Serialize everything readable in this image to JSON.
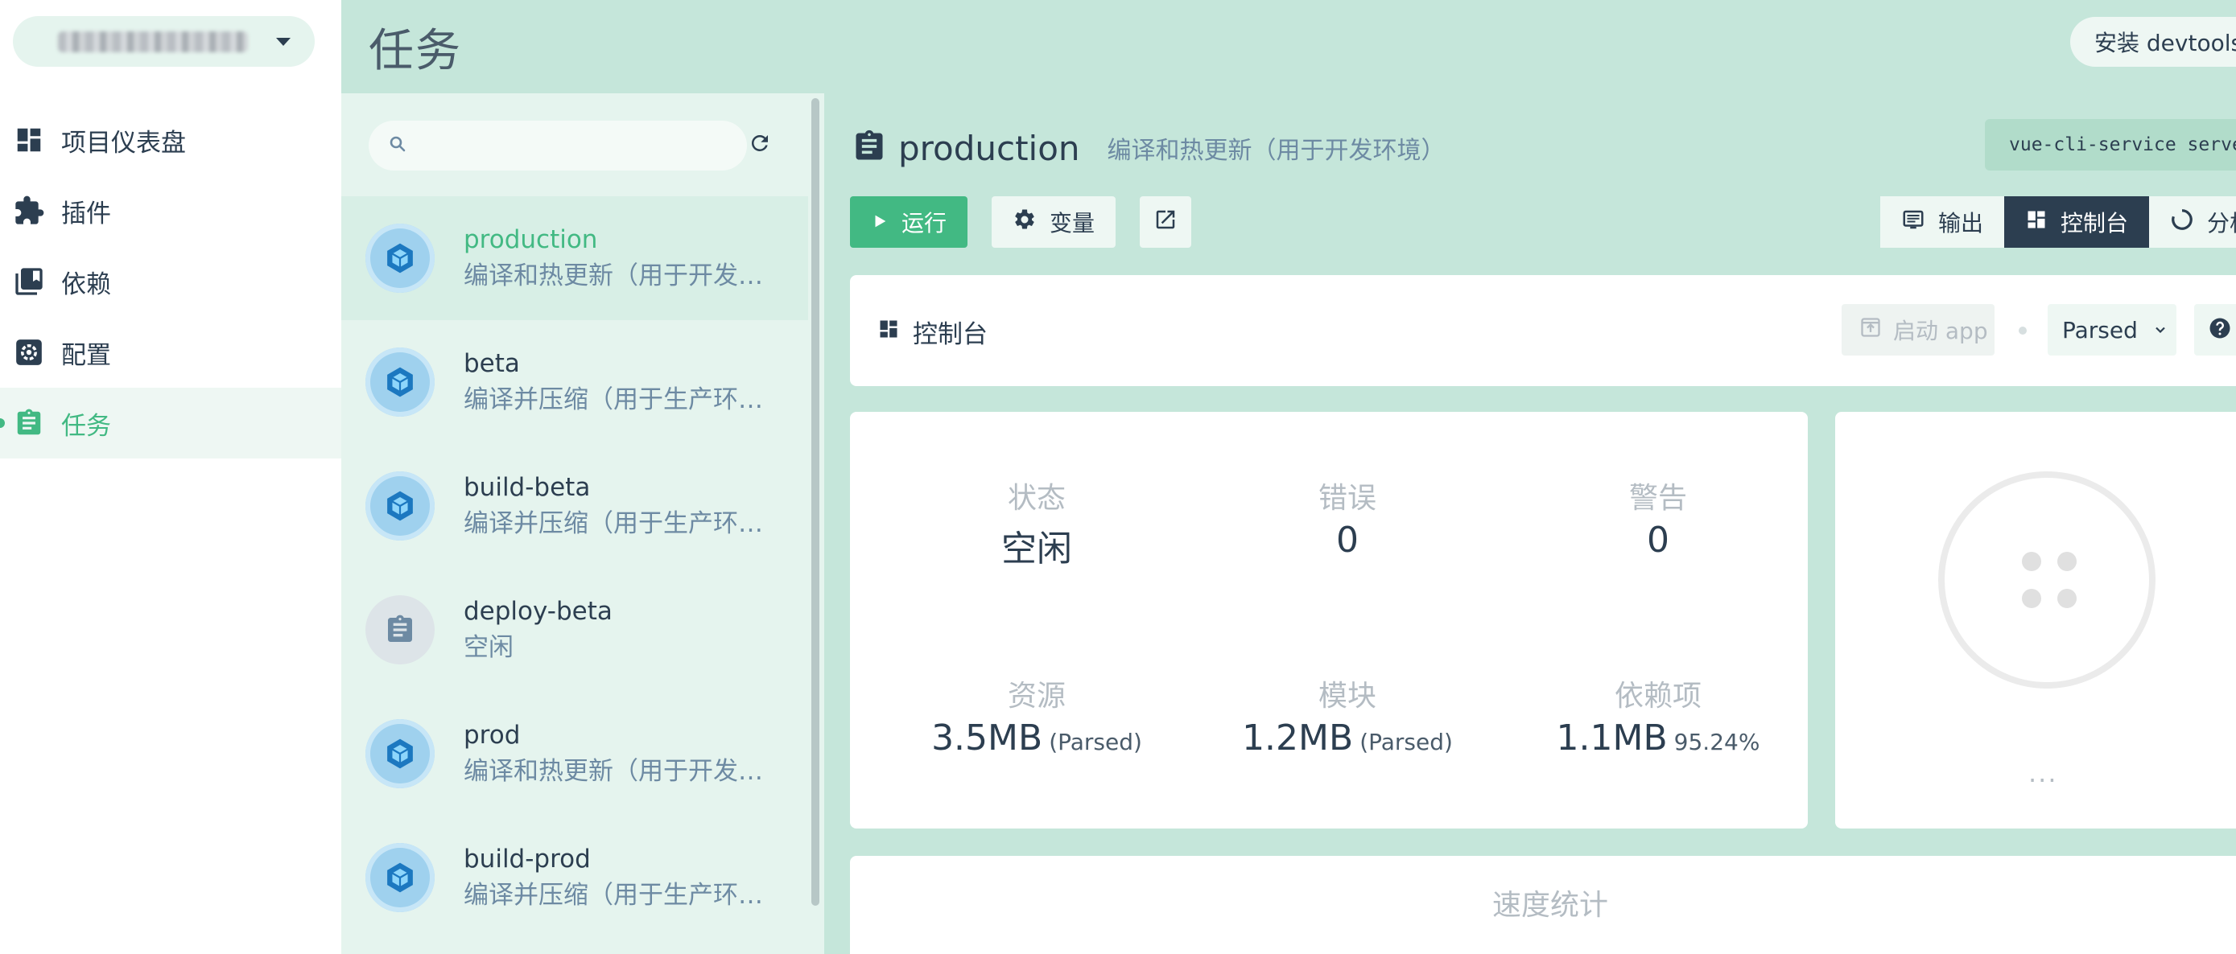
{
  "nav": {
    "items": [
      {
        "label": "项目仪表盘",
        "icon": "dashboard-icon"
      },
      {
        "label": "插件",
        "icon": "puzzle-icon"
      },
      {
        "label": "依赖",
        "icon": "library-icon"
      },
      {
        "label": "配置",
        "icon": "settings-icon"
      },
      {
        "label": "任务",
        "icon": "clipboard-icon",
        "active": true
      }
    ]
  },
  "header": {
    "title": "任务",
    "devtools_label": "安装 devtools"
  },
  "search": {
    "placeholder": ""
  },
  "tasks": [
    {
      "name": "production",
      "desc": "编译和热更新（用于开发环境）",
      "selected": true
    },
    {
      "name": "beta",
      "desc": "编译并压缩（用于生产环境）"
    },
    {
      "name": "build-beta",
      "desc": "编译并压缩（用于生产环境）"
    },
    {
      "name": "deploy-beta",
      "desc": "空闲"
    },
    {
      "name": "prod",
      "desc": "编译和热更新（用于开发环境）"
    },
    {
      "name": "build-prod",
      "desc": "编译并压缩（用于生产环境）"
    }
  ],
  "task_detail": {
    "title": "production",
    "desc": "编译和热更新（用于开发环境）",
    "command": "vue-cli-service serve"
  },
  "toolbar": {
    "run_label": "运行",
    "vars_label": "变量"
  },
  "view_tabs": {
    "output": "输出",
    "console": "控制台",
    "analyze": "分析"
  },
  "console": {
    "title": "控制台",
    "start_app": "启动 app",
    "mode": "Parsed"
  },
  "stats": {
    "status": {
      "label": "状态",
      "value": "空闲"
    },
    "errors": {
      "label": "错误",
      "value": "0"
    },
    "warnings": {
      "label": "警告",
      "value": "0"
    },
    "assets": {
      "label": "资源",
      "value": "3.5MB",
      "note": "(Parsed)"
    },
    "modules": {
      "label": "模块",
      "value": "1.2MB",
      "note": "(Parsed)"
    },
    "deps": {
      "label": "依赖项",
      "value": "1.1MB",
      "note": "95.24%"
    }
  },
  "chart": {
    "more": "..."
  },
  "speed": {
    "title": "速度统计"
  },
  "colors": {
    "accent": "#42b983",
    "header_bg": "#c5e6da",
    "dark": "#2c3e50"
  }
}
